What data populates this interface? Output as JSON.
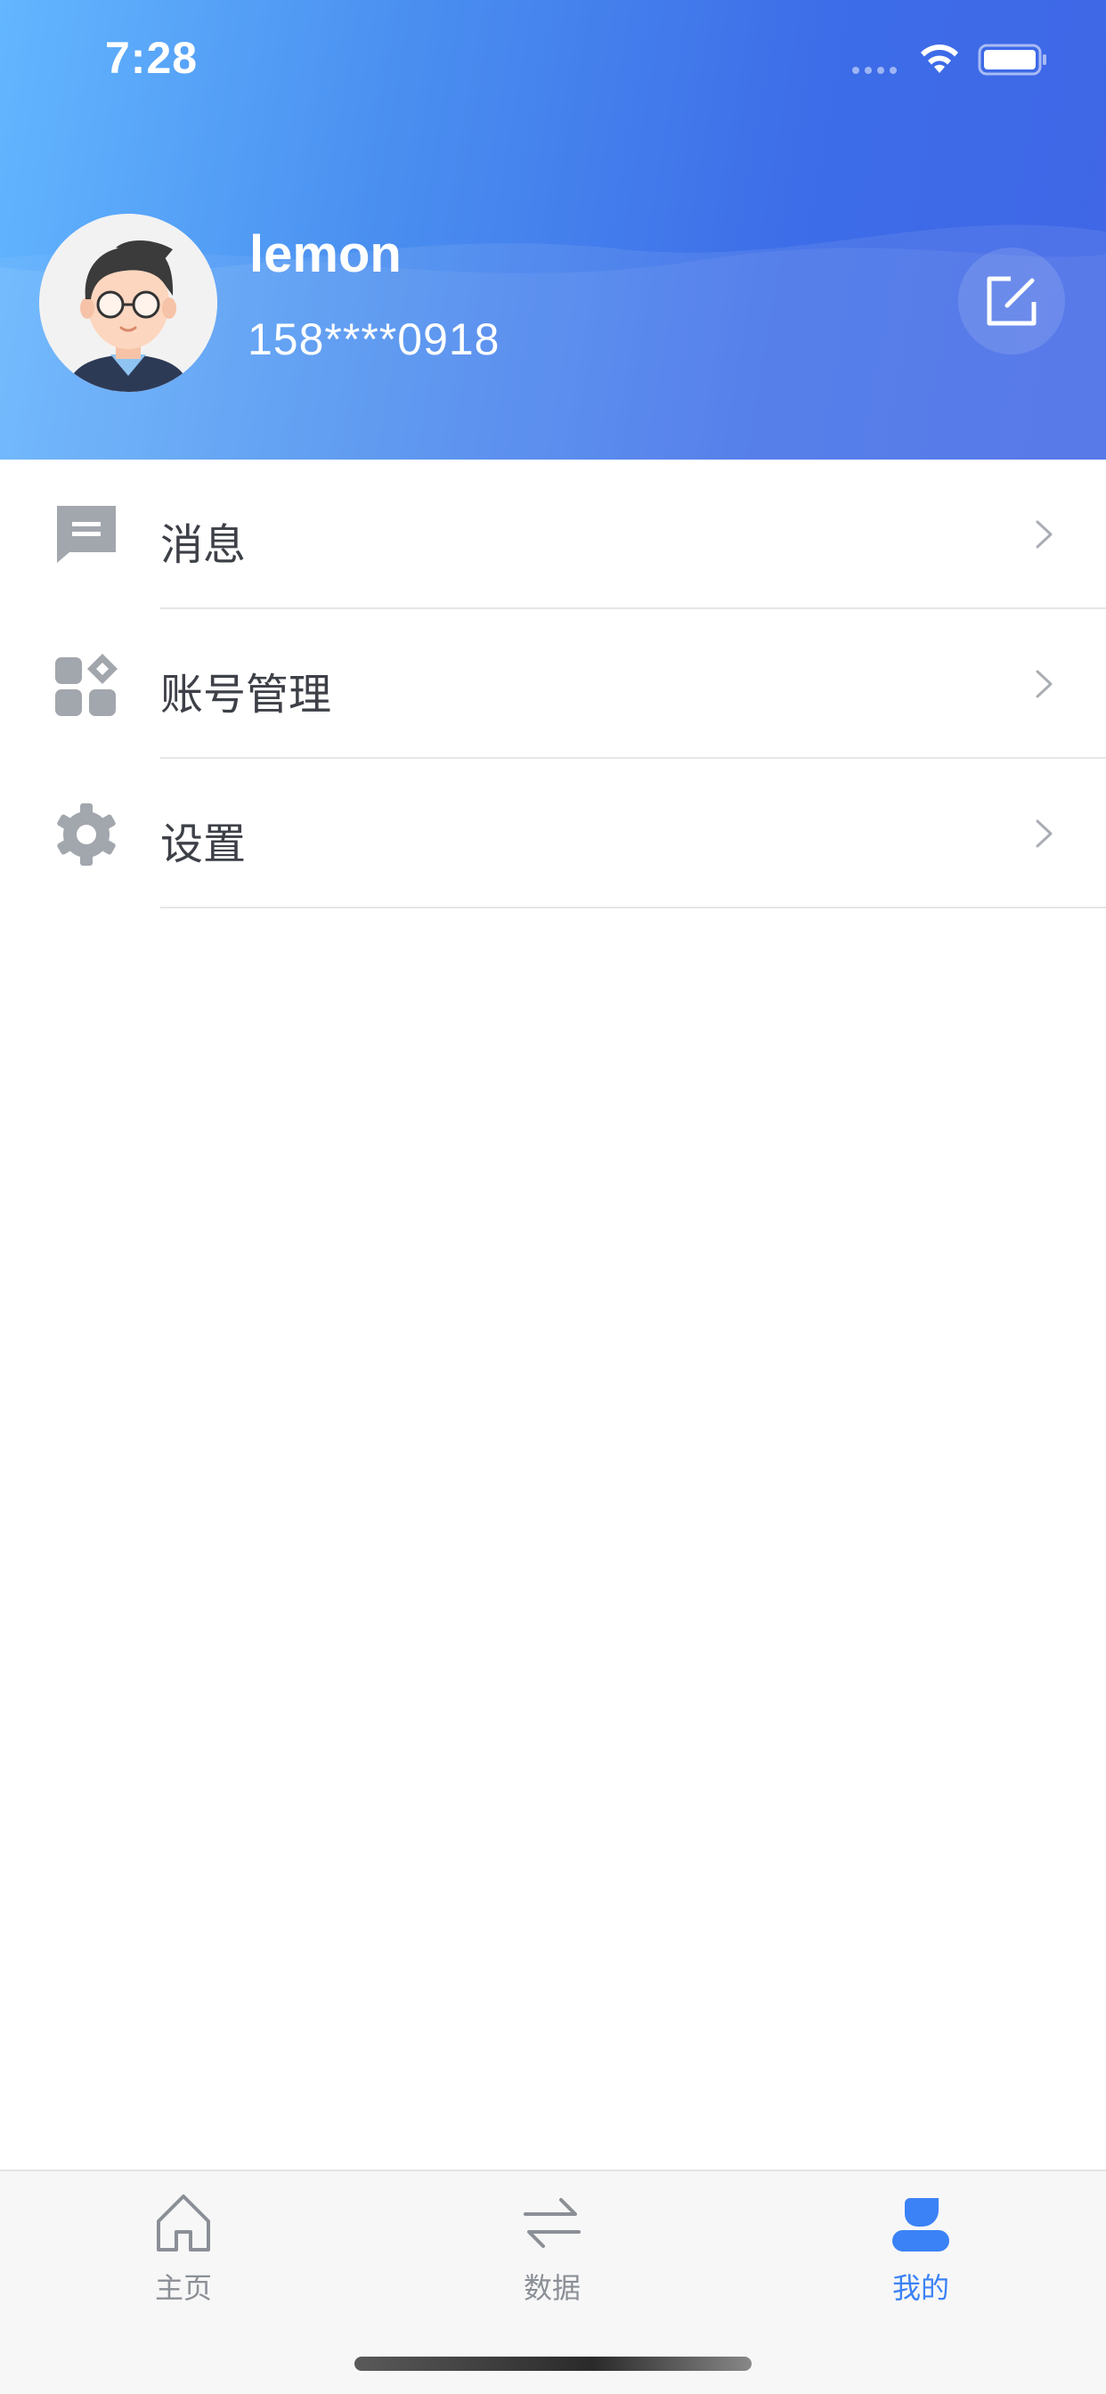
{
  "status_bar": {
    "time": "7:28",
    "wifi_icon": "wifi-icon",
    "battery_icon": "battery-icon"
  },
  "profile": {
    "username": "lemon",
    "phone": "158****0918",
    "avatar_icon": "avatar-illustration",
    "edit_icon": "edit-icon"
  },
  "menu": {
    "items": [
      {
        "label": "消息",
        "icon": "message-icon"
      },
      {
        "label": "账号管理",
        "icon": "apps-icon"
      },
      {
        "label": "设置",
        "icon": "gear-icon"
      }
    ]
  },
  "tabbar": {
    "tabs": [
      {
        "label": "主页",
        "icon": "home-icon",
        "active": false
      },
      {
        "label": "数据",
        "icon": "swap-arrows-icon",
        "active": false
      },
      {
        "label": "我的",
        "icon": "user-icon",
        "active": true
      }
    ]
  },
  "colors": {
    "header_start": "#63b6ff",
    "header_end": "#3f66e6",
    "accent": "#3b82f6",
    "icon_gray": "#a2a6ad",
    "text_dark": "#3d4047"
  }
}
